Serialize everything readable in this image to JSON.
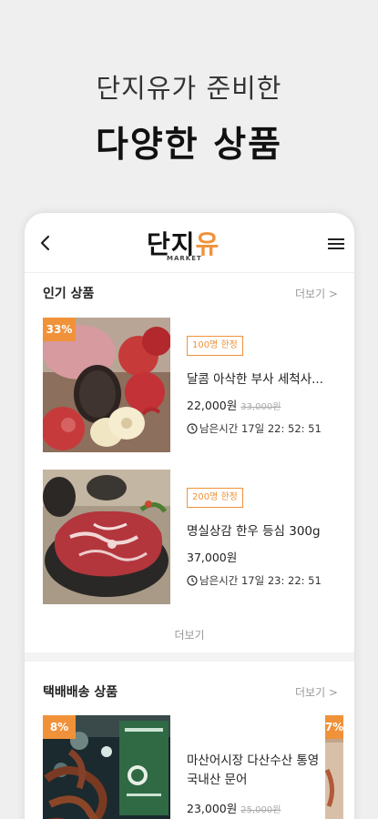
{
  "hero": {
    "subtitle": "단지유가 준비한",
    "title": "다양한 상품"
  },
  "app": {
    "logo_text": "단지",
    "logo_accent": "유",
    "logo_sub": "MARKET",
    "brand_color": "#f0923a"
  },
  "popular": {
    "title": "인기 상품",
    "more_link": "더보기 >",
    "products": [
      {
        "discount": "33%",
        "badge": "100명 한정",
        "name": "달콤 아삭한 부사 세척사...",
        "price": "22,000원",
        "original_price": "33,000원",
        "timer": "남은시간 17일 22: 52: 51"
      },
      {
        "badge": "200명 한정",
        "name": "명실상감 한우 등심 300g",
        "price": "37,000원",
        "timer": "남은시간 17일 23: 22: 51"
      }
    ],
    "more_button": "더보기"
  },
  "delivery": {
    "title": "택배배송 상품",
    "more_link": "더보기 >",
    "products": [
      {
        "discount": "8%",
        "name": "마산어시장 다산수산 통영 국내산 문어",
        "price": "23,000원",
        "original_price": "25,000원"
      },
      {
        "discount": "7%"
      }
    ]
  }
}
